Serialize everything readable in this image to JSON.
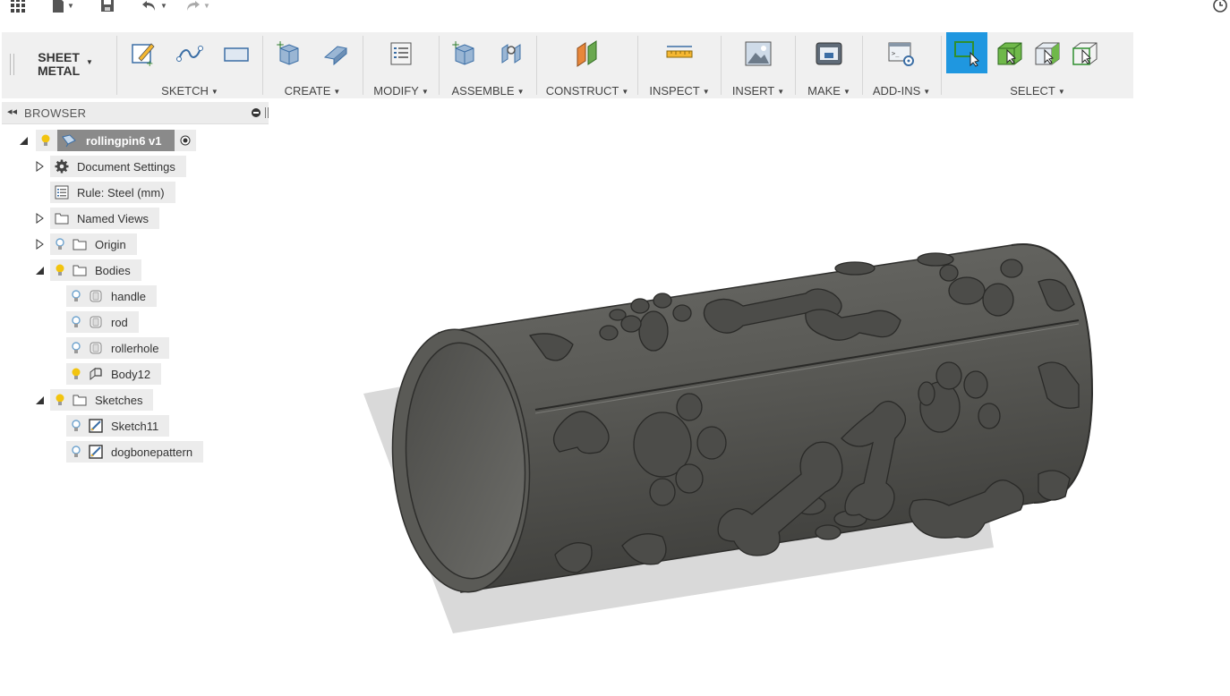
{
  "app": {
    "quick_access": {
      "icons": [
        "app-grid-icon",
        "file-icon",
        "save-icon",
        "undo-icon",
        "redo-icon",
        "job-status-icon"
      ]
    }
  },
  "toolbar": {
    "workspace": {
      "line1": "SHEET",
      "line2": "METAL"
    },
    "groups": [
      {
        "label": "SKETCH",
        "icons": [
          "create-sketch-icon",
          "spline-icon",
          "rectangle-icon"
        ]
      },
      {
        "label": "CREATE",
        "icons": [
          "new-component-icon",
          "flange-icon"
        ]
      },
      {
        "label": "MODIFY",
        "icons": [
          "sheet-metal-rules-icon"
        ]
      },
      {
        "label": "ASSEMBLE",
        "icons": [
          "new-component-assemble-icon",
          "joint-icon"
        ]
      },
      {
        "label": "CONSTRUCT",
        "icons": [
          "offset-plane-icon"
        ]
      },
      {
        "label": "INSPECT",
        "icons": [
          "measure-icon"
        ]
      },
      {
        "label": "INSERT",
        "icons": [
          "insert-image-icon"
        ]
      },
      {
        "label": "MAKE",
        "icons": [
          "3d-print-icon"
        ]
      },
      {
        "label": "ADD-INS",
        "icons": [
          "scripts-addins-icon"
        ]
      },
      {
        "label": "SELECT",
        "icons": [
          "window-select-icon",
          "select-body-icon",
          "select-face-icon",
          "select-through-icon"
        ]
      }
    ]
  },
  "browser": {
    "title": "BROWSER",
    "root": {
      "label": "rollingpin6 v1"
    },
    "items": {
      "document_settings": "Document Settings",
      "rule": "Rule: Steel (mm)",
      "named_views": "Named Views",
      "origin": "Origin",
      "bodies": "Bodies",
      "handle": "handle",
      "rod": "rod",
      "rollerhole": "rollerhole",
      "body12": "Body12",
      "sketches": "Sketches",
      "sketch11": "Sketch11",
      "dogbonepattern": "dogbonepattern"
    }
  },
  "colors": {
    "accent": "#1f97e0",
    "toolbar_bg": "#f0f0f0",
    "model": "#5a5a56",
    "shadow": "#d8d8d8",
    "bulb_on": "#f2c40f",
    "bulb_off": "#6fa4cf"
  }
}
